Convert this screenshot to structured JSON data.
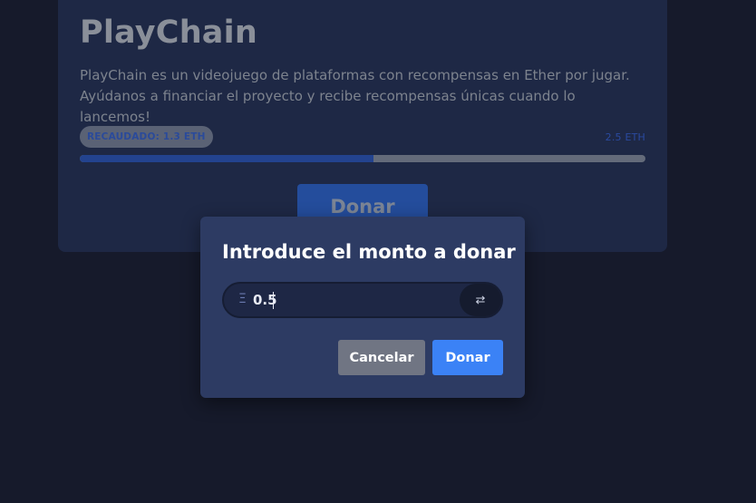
{
  "project": {
    "title": "PlayChain",
    "description_line1": "PlayChain es un videojuego de plataformas con recompensas en Ether por jugar.",
    "description_line2": "Ayúdanos a financiar el proyecto y recibe recompensas únicas cuando lo lancemos!",
    "raised_label": "RECAUDADO: 1.3 ETH",
    "goal_label": "2.5 ETH",
    "progress_fraction": 0.52,
    "donate_label": "Donar"
  },
  "modal": {
    "title": "Introduce el monto a donar",
    "currency_symbol": "Ξ",
    "amount_value": "0.5",
    "swap_icon": "swap-arrows-icon",
    "swap_glyph": "⇄",
    "cancel_label": "Cancelar",
    "confirm_label": "Donar"
  },
  "colors": {
    "background": "#161a2b",
    "card": "#1e2845",
    "modal": "#2d3b63",
    "accent": "#3b82f6",
    "cancel": "#707583"
  }
}
